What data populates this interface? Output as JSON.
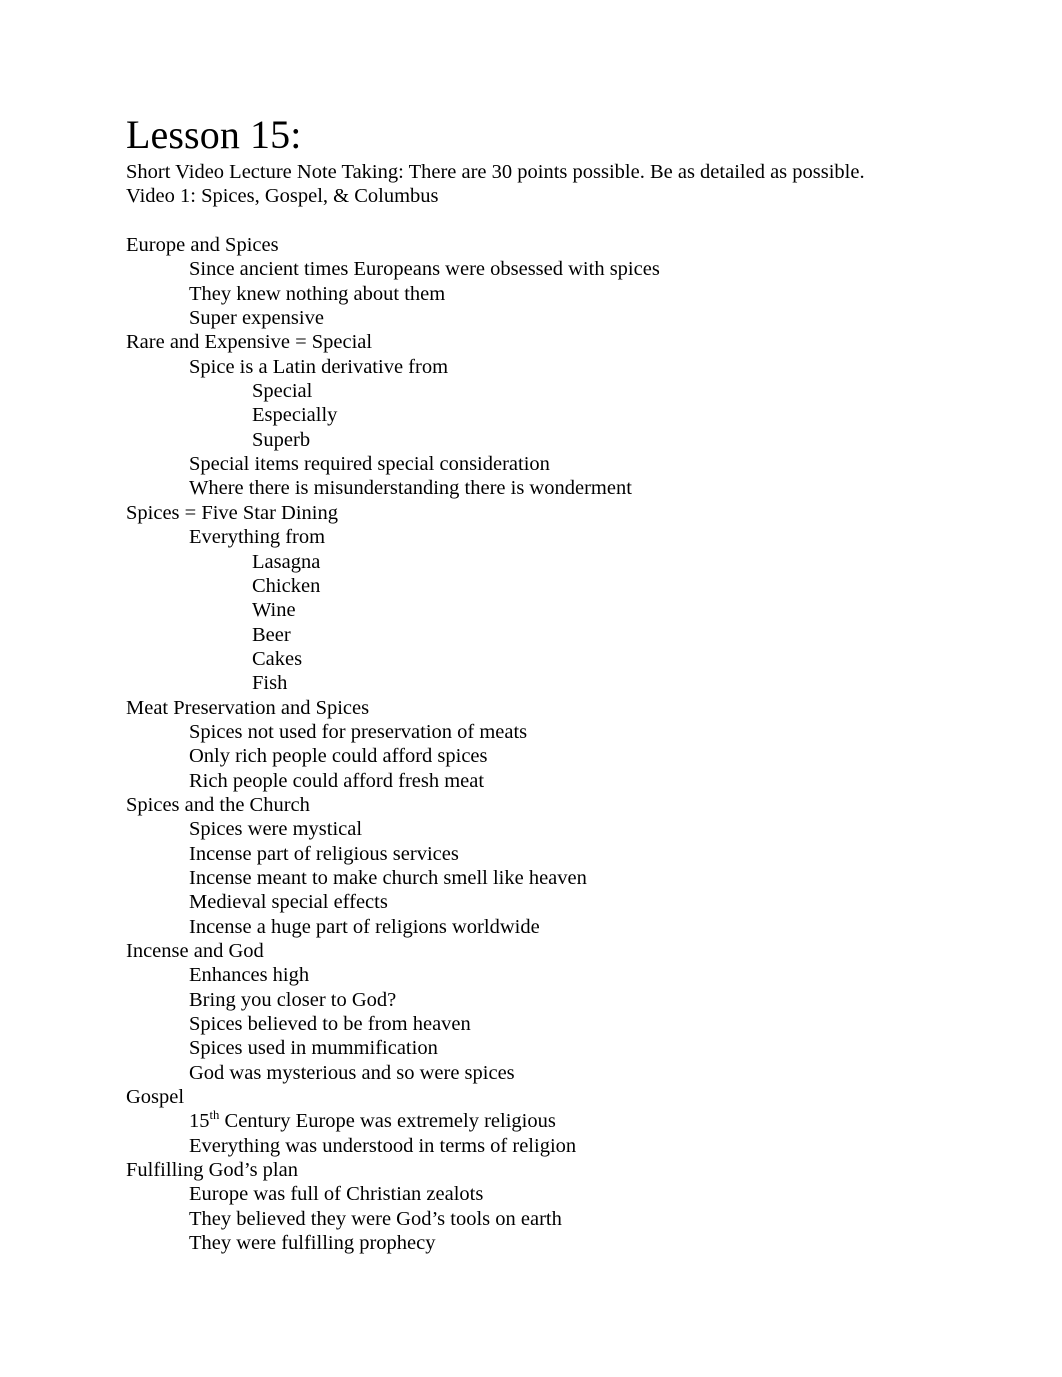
{
  "document": {
    "title": "Lesson 15:",
    "intro_lines": [
      "Short Video Lecture Note Taking: There are 30 points possible. Be as detailed as possible.",
      "Video 1: Spices, Gospel, & Columbus"
    ],
    "text_color": "#000000",
    "background_color": "#ffffff",
    "outline": [
      {
        "level": 0,
        "text": "Europe and Spices"
      },
      {
        "level": 1,
        "text": "Since ancient times Europeans were obsessed with spices"
      },
      {
        "level": 1,
        "text": "They knew nothing about them"
      },
      {
        "level": 1,
        "text": "Super expensive"
      },
      {
        "level": 0,
        "text": "Rare and Expensive = Special"
      },
      {
        "level": 1,
        "text": "Spice is a Latin derivative from"
      },
      {
        "level": 2,
        "text": "Special"
      },
      {
        "level": 2,
        "text": "Especially"
      },
      {
        "level": 2,
        "text": "Superb"
      },
      {
        "level": 1,
        "text": "Special items required special consideration"
      },
      {
        "level": 1,
        "text": "Where there is misunderstanding there is wonderment"
      },
      {
        "level": 0,
        "text": "Spices = Five Star Dining"
      },
      {
        "level": 1,
        "text": "Everything from"
      },
      {
        "level": 2,
        "text": "Lasagna"
      },
      {
        "level": 2,
        "text": "Chicken"
      },
      {
        "level": 2,
        "text": "Wine"
      },
      {
        "level": 2,
        "text": "Beer"
      },
      {
        "level": 2,
        "text": "Cakes"
      },
      {
        "level": 2,
        "text": "Fish"
      },
      {
        "level": 0,
        "text": "Meat Preservation and Spices"
      },
      {
        "level": 1,
        "text": "Spices not used for preservation of meats"
      },
      {
        "level": 1,
        "text": "Only rich people could afford spices"
      },
      {
        "level": 1,
        "text": "Rich people could afford fresh meat"
      },
      {
        "level": 0,
        "text": "Spices and the Church"
      },
      {
        "level": 1,
        "text": "Spices were mystical"
      },
      {
        "level": 1,
        "text": "Incense part of religious services"
      },
      {
        "level": 1,
        "text": "Incense meant to make church smell like heaven"
      },
      {
        "level": 1,
        "text": "Medieval special effects"
      },
      {
        "level": 1,
        "text": "Incense a huge part of religions worldwide"
      },
      {
        "level": 0,
        "text": "Incense and God"
      },
      {
        "level": 1,
        "text": "Enhances high"
      },
      {
        "level": 1,
        "text": "Bring you closer to God?"
      },
      {
        "level": 1,
        "text": "Spices believed to be from heaven"
      },
      {
        "level": 1,
        "text": "Spices used in mummification"
      },
      {
        "level": 1,
        "text": "God was mysterious and so were spices"
      },
      {
        "level": 0,
        "text": "Gospel"
      },
      {
        "level": 1,
        "text": "15th Century Europe was extremely religious",
        "superscript": {
          "base": "15",
          "sup": "th",
          "rest": " Century Europe was extremely religious"
        }
      },
      {
        "level": 1,
        "text": "Everything was understood in terms of religion"
      },
      {
        "level": 0,
        "text": "Fulfilling God’s plan"
      },
      {
        "level": 1,
        "text": "Europe was full of Christian zealots"
      },
      {
        "level": 1,
        "text": "They believed they were God’s tools on earth"
      },
      {
        "level": 1,
        "text": "They were fulfilling prophecy"
      }
    ]
  }
}
